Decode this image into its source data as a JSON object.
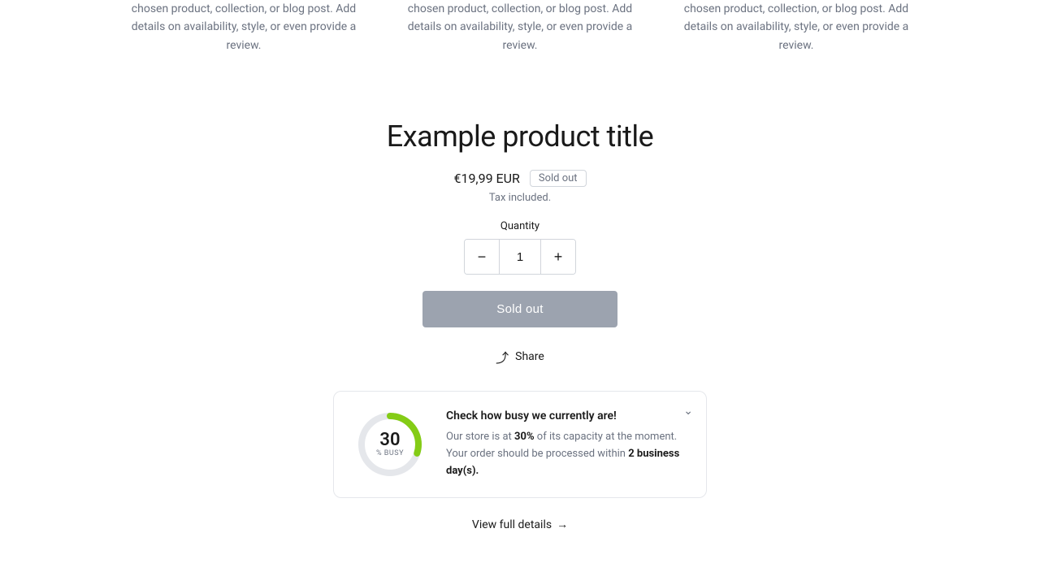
{
  "top_columns": [
    {
      "text": "chosen product, collection, or blog post. Add details on availability, style, or even provide a review."
    },
    {
      "text": "chosen product, collection, or blog post. Add details on availability, style, or even provide a review."
    },
    {
      "text": "chosen product, collection, or blog post. Add details on availability, style, or even provide a review."
    }
  ],
  "product": {
    "title": "Example product title",
    "price": "€19,99 EUR",
    "sold_out_badge": "Sold out",
    "tax_text": "Tax included.",
    "quantity_label": "Quantity",
    "quantity_value": "1",
    "decrease_label": "−",
    "increase_label": "+",
    "sold_out_button": "Sold out",
    "share_label": "Share"
  },
  "busy_widget": {
    "title": "Check how busy we currently are!",
    "percent": 30,
    "percent_label": "30",
    "sub_label": "% BUSY",
    "description_prefix": "Our store is at ",
    "description_bold": "30%",
    "description_mid": " of its capacity at the moment. Your order should be processed within ",
    "description_bold2": "2 business day(s).",
    "circumference": 219.9,
    "fill_amount": 66
  },
  "view_full_details": "View full details"
}
